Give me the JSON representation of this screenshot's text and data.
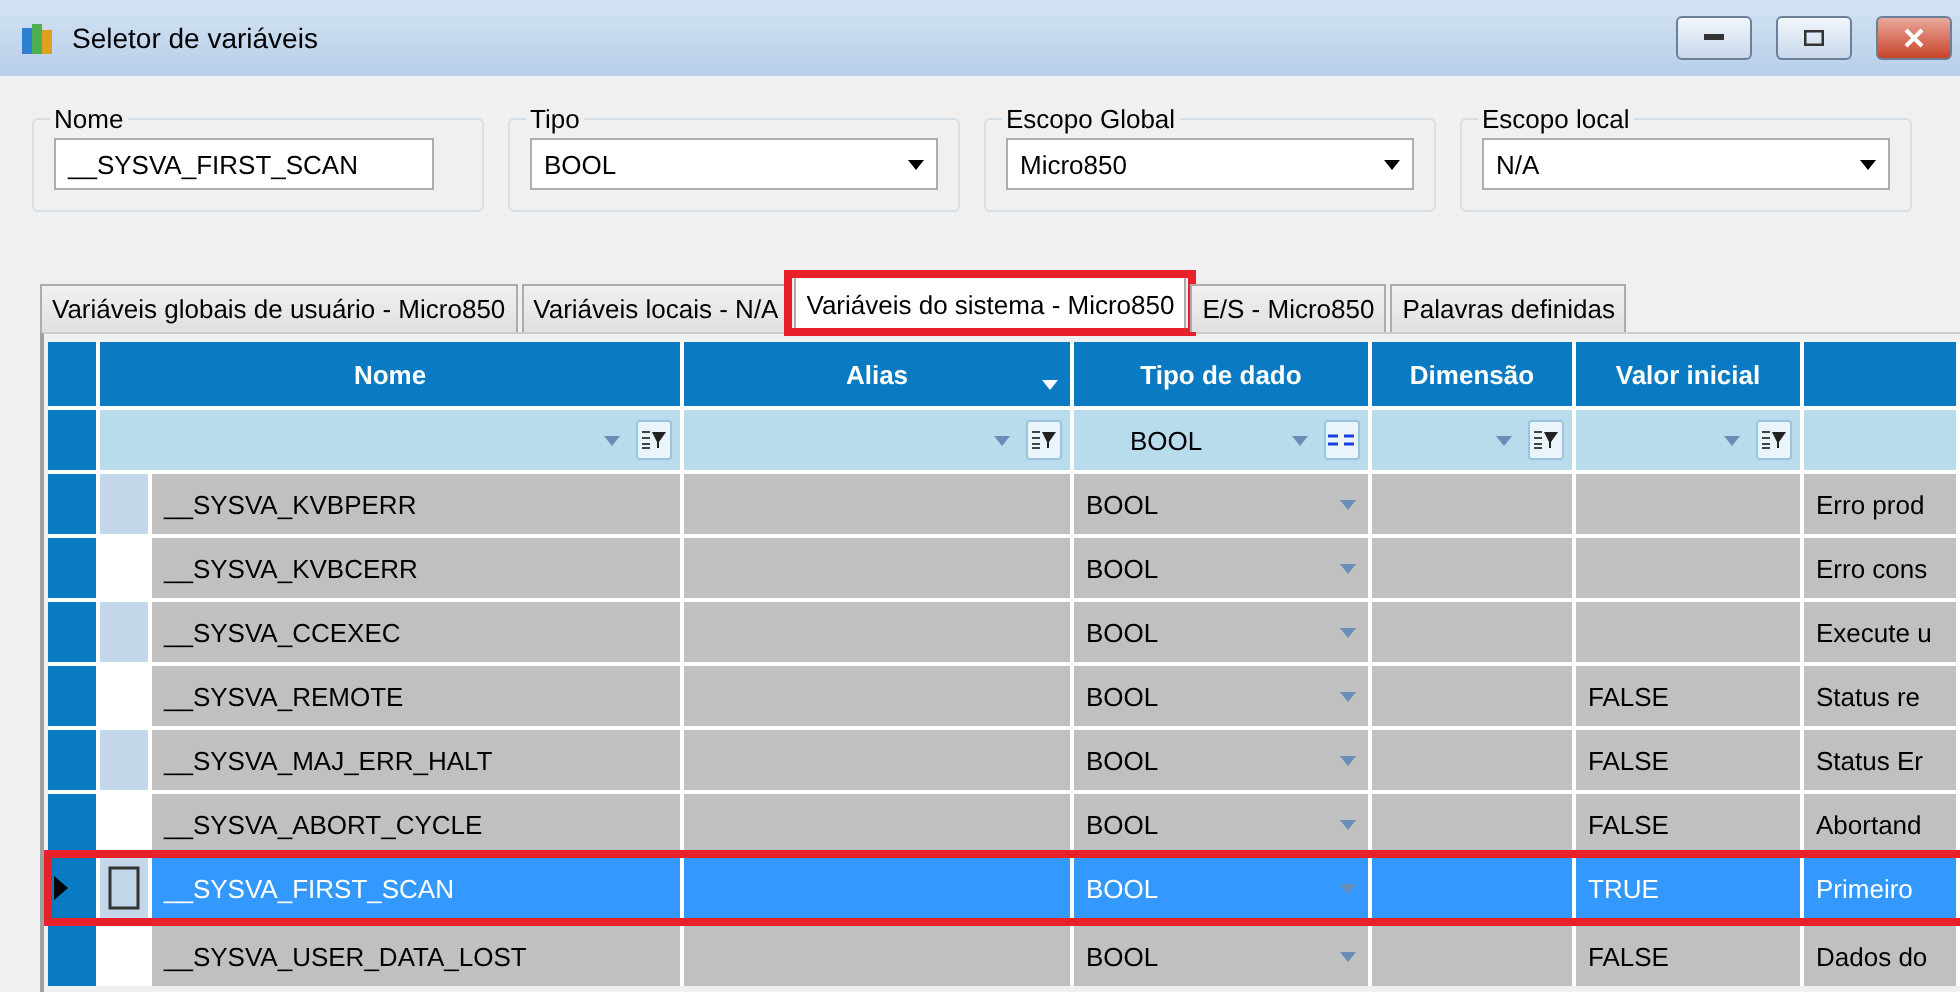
{
  "window": {
    "title": "Seletor de variáveis"
  },
  "filters": [
    {
      "label": "Nome",
      "value": "__SYSVA_FIRST_SCAN",
      "kind": "text"
    },
    {
      "label": "Tipo",
      "value": "BOOL",
      "kind": "dropdown"
    },
    {
      "label": "Escopo Global",
      "value": "Micro850",
      "kind": "dropdown"
    },
    {
      "label": "Escopo local",
      "value": "N/A",
      "kind": "dropdown"
    }
  ],
  "tabs": [
    {
      "label": "Variáveis globais de usuário - Micro850",
      "selected": false,
      "highlighted": false
    },
    {
      "label": "Variáveis locais - N/A",
      "selected": false,
      "highlighted": false
    },
    {
      "label": "Variáveis do sistema - Micro850",
      "selected": true,
      "highlighted": true
    },
    {
      "label": "E/S - Micro850",
      "selected": false,
      "highlighted": false
    },
    {
      "label": "Palavras definidas",
      "selected": false,
      "highlighted": false
    }
  ],
  "table": {
    "columns": [
      {
        "label": "Nome",
        "sort_menu": false,
        "kind": "list"
      },
      {
        "label": "Alias",
        "sort_menu": true,
        "kind": "list"
      },
      {
        "label": "Tipo de dado",
        "sort_menu": false,
        "filter": "BOOL",
        "kind": "equals"
      },
      {
        "label": "Dimensão",
        "sort_menu": false,
        "kind": "list"
      },
      {
        "label": "Valor inicial",
        "sort_menu": false,
        "kind": "list"
      }
    ],
    "rows": [
      {
        "name": "__SYSVA_KVBPERR",
        "alias": "",
        "type": "BOOL",
        "dimension": "",
        "initial": "",
        "description": "Erro prod",
        "marked": true,
        "selected": false,
        "highlighted": false
      },
      {
        "name": "__SYSVA_KVBCERR",
        "alias": "",
        "type": "BOOL",
        "dimension": "",
        "initial": "",
        "description": "Erro cons",
        "marked": false,
        "selected": false,
        "highlighted": false
      },
      {
        "name": "__SYSVA_CCEXEC",
        "alias": "",
        "type": "BOOL",
        "dimension": "",
        "initial": "",
        "description": "Execute u",
        "marked": true,
        "selected": false,
        "highlighted": false
      },
      {
        "name": "__SYSVA_REMOTE",
        "alias": "",
        "type": "BOOL",
        "dimension": "",
        "initial": "FALSE",
        "description": "Status re",
        "marked": false,
        "selected": false,
        "highlighted": false
      },
      {
        "name": "__SYSVA_MAJ_ERR_HALT",
        "alias": "",
        "type": "BOOL",
        "dimension": "",
        "initial": "FALSE",
        "description": "Status Er",
        "marked": true,
        "selected": false,
        "highlighted": false
      },
      {
        "name": "__SYSVA_ABORT_CYCLE",
        "alias": "",
        "type": "BOOL",
        "dimension": "",
        "initial": "FALSE",
        "description": "Abortand",
        "marked": false,
        "selected": false,
        "highlighted": false
      },
      {
        "name": "__SYSVA_FIRST_SCAN",
        "alias": "",
        "type": "BOOL",
        "dimension": "",
        "initial": "TRUE",
        "description": "Primeiro",
        "marked": true,
        "selected": true,
        "highlighted": true
      },
      {
        "name": "__SYSVA_USER_DATA_LOST",
        "alias": "",
        "type": "BOOL",
        "dimension": "",
        "initial": "FALSE",
        "description": "Dados do",
        "marked": false,
        "selected": false,
        "highlighted": false
      }
    ]
  }
}
